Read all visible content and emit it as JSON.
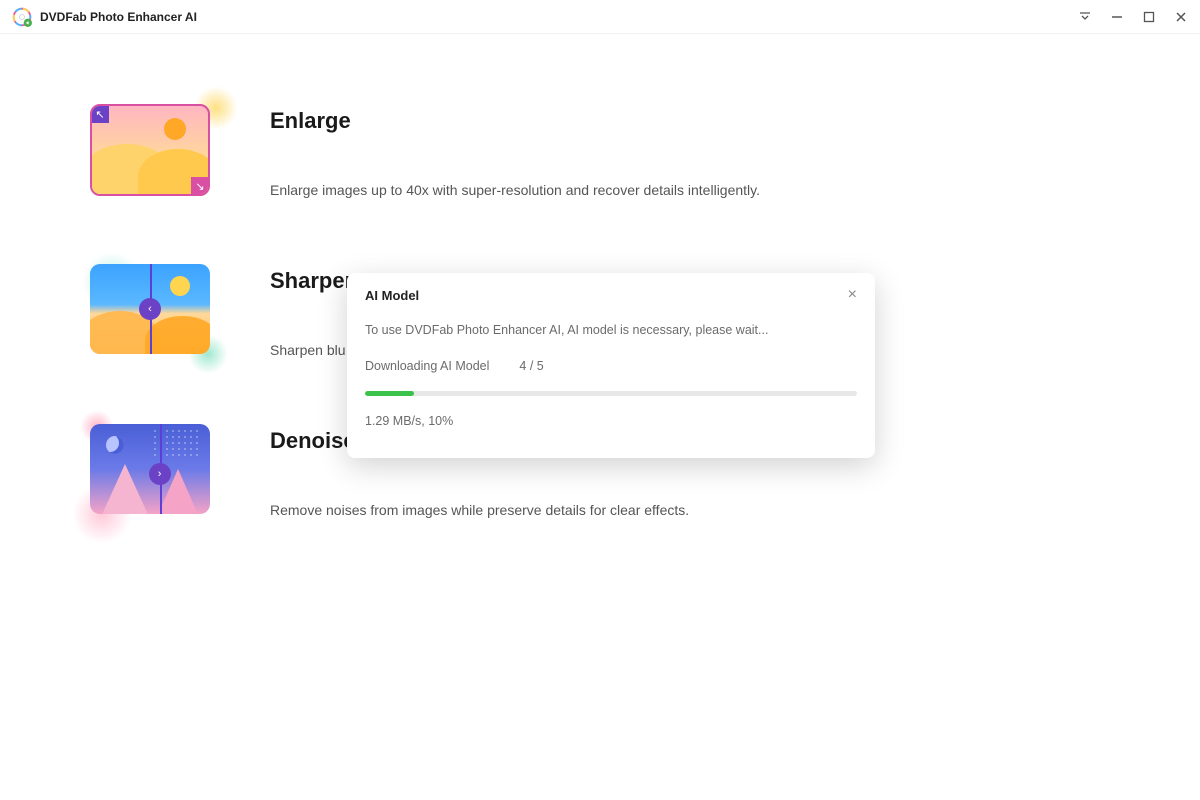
{
  "app": {
    "title": "DVDFab Photo Enhancer AI"
  },
  "features": [
    {
      "title": "Enlarge",
      "desc": "Enlarge images up to 40x with super-resolution and recover details intelligently."
    },
    {
      "title": "Sharpen",
      "desc": "Sharpen blu"
    },
    {
      "title": "Denoise",
      "desc": "Remove noises from images while preserve details for clear effects."
    }
  ],
  "modal": {
    "title": "AI Model",
    "message": "To use DVDFab Photo Enhancer AI, AI model is necessary, please wait...",
    "downloading_label": "Downloading AI Model",
    "progress_count": "4 / 5",
    "progress_percent": 10,
    "stats": "1.29 MB/s,  10%"
  }
}
